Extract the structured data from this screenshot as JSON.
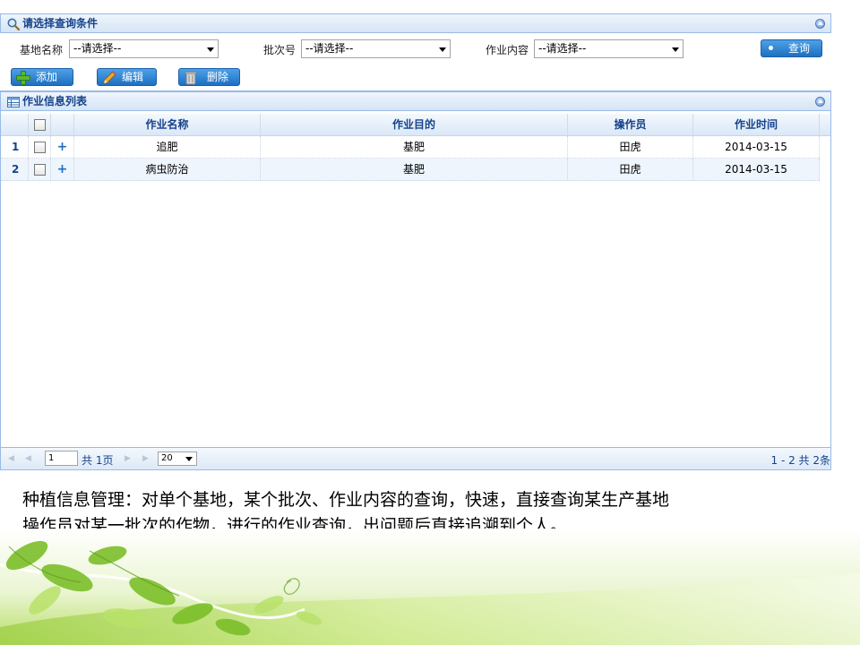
{
  "query_panel": {
    "title": "请选择查询条件",
    "fields": [
      {
        "label": "基地名称",
        "value": "--请选择--"
      },
      {
        "label": "批次号",
        "value": "--请选择--"
      },
      {
        "label": "作业内容",
        "value": "--请选择--"
      }
    ],
    "query_button": "查询"
  },
  "toolbar": {
    "add": "添加",
    "edit": "编辑",
    "delete": "删除"
  },
  "grid": {
    "title": "作业信息列表",
    "columns": [
      "作业名称",
      "作业目的",
      "操作员",
      "作业时间"
    ],
    "rows": [
      {
        "num": "1",
        "expand": "+",
        "name": "追肥",
        "purpose": "基肥",
        "operator": "田虎",
        "time": "2014-03-15"
      },
      {
        "num": "2",
        "expand": "+",
        "name": "病虫防治",
        "purpose": "基肥",
        "operator": "田虎",
        "time": "2014-03-15"
      }
    ],
    "pager": {
      "page": "1",
      "total_pages": "共 1页",
      "page_size": "20",
      "summary": "1 - 2  共 2条"
    }
  },
  "caption": {
    "line1": "种植信息管理：对单个基地，某个批次、作业内容的查询，快速，直接查询某生产基地",
    "line2": "操作员对某一批次的作物，进行的作业查询，出问题后直接追溯到个人。"
  },
  "colors": {
    "header_text": "#15428b",
    "border": "#99bbe8",
    "button": "#1d6fc2",
    "leaf_green": "#8cc63f"
  }
}
